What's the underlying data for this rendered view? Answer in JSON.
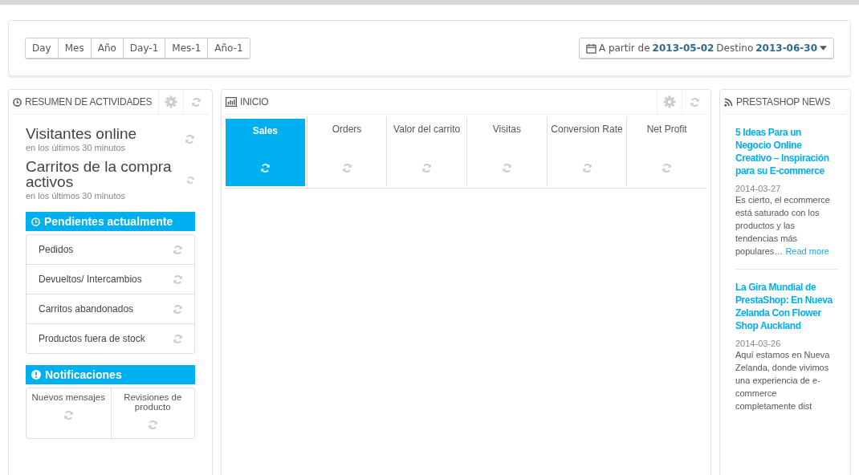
{
  "range_buttons": [
    {
      "label": "Day"
    },
    {
      "label": "Mes"
    },
    {
      "label": "Año"
    },
    {
      "label": "Day-1"
    },
    {
      "label": "Mes-1"
    },
    {
      "label": "Año-1"
    }
  ],
  "date_range": {
    "from_label": "A partir de",
    "from": "2013-05-02",
    "to_label": "Destino",
    "to": "2013-06-30"
  },
  "activity": {
    "title": "RESUMEN DE ACTIVIDADES",
    "stats": [
      {
        "label": "Visitantes online",
        "sub": "en los últimos 30 minutos"
      },
      {
        "label": "Carritos de la compra activos",
        "sub": "en los últimos 30 minutos"
      }
    ],
    "pending": {
      "title": "Pendientes actualmente",
      "items": [
        "Pedidos",
        "Devueltos/ Intercambios",
        "Carritos abandonados",
        "Productos fuera de stock"
      ]
    },
    "notifications": {
      "title": "Notificaciones",
      "items": [
        "Nuevos mensajes",
        "Revisiones de producto"
      ]
    }
  },
  "dashboard": {
    "title": "INICIO",
    "tabs": [
      {
        "label": "Sales",
        "selected": true
      },
      {
        "label": "Orders",
        "selected": false
      },
      {
        "label": "Valor del carrito",
        "selected": false
      },
      {
        "label": "Visitas",
        "selected": false
      },
      {
        "label": "Conversion Rate",
        "selected": false
      },
      {
        "label": "Net Profit",
        "selected": false
      }
    ]
  },
  "news": {
    "title": "PRESTASHOP NEWS",
    "articles": [
      {
        "title": "5 Ideas Para un Negocio Online Creativo – Inspiración para su E-commerce",
        "date": "2014-03-27",
        "excerpt": "Es cierto, el ecommerce está saturado con los productos y las tendencias más populares…",
        "link": "Read more"
      },
      {
        "title": "La Gira Mundial de PrestaShop: En Nueva Zelanda Con Flower Shop Auckland",
        "date": "2014-03-26",
        "excerpt": "Aquí estamos en Nueva Zelanda, donde vivimos una experiencia de e-commerce completamente dist"
      }
    ]
  }
}
